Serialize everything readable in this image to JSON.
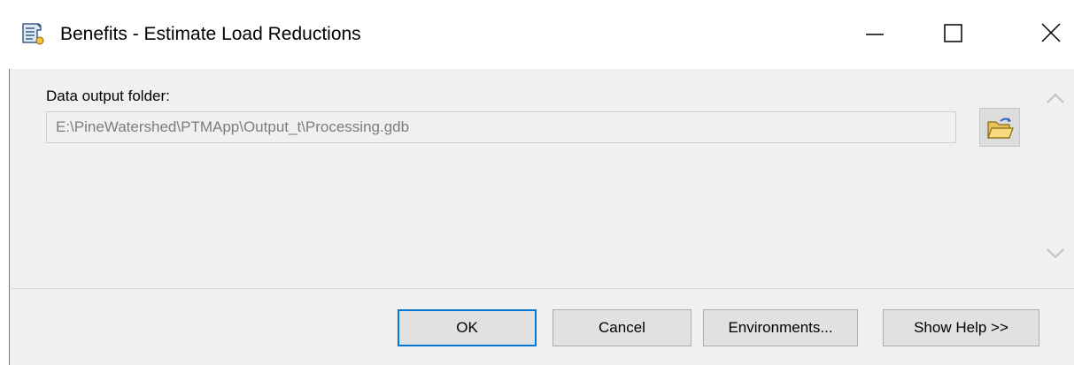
{
  "window": {
    "title": "Benefits - Estimate Load Reductions",
    "title_icon": "script-tool-icon",
    "controls": [
      "minimize-icon",
      "maximize-icon",
      "close-icon"
    ]
  },
  "form": {
    "output_folder_label": "Data output folder:",
    "output_folder_value": "E:\\PineWatershed\\PTMApp\\Output_t\\Processing.gdb",
    "browse_icon": "open-folder-icon"
  },
  "scrollbar": {
    "up_icon": "chevron-up-icon",
    "down_icon": "chevron-down-icon"
  },
  "buttons": {
    "ok": "OK",
    "cancel": "Cancel",
    "environments": "Environments...",
    "show_help": "Show Help >>"
  },
  "colors": {
    "focus_border": "#0078d7",
    "panel_bg": "#f0f0f0",
    "button_bg": "#e1e1e1",
    "disabled_text": "#7d7d7d"
  }
}
